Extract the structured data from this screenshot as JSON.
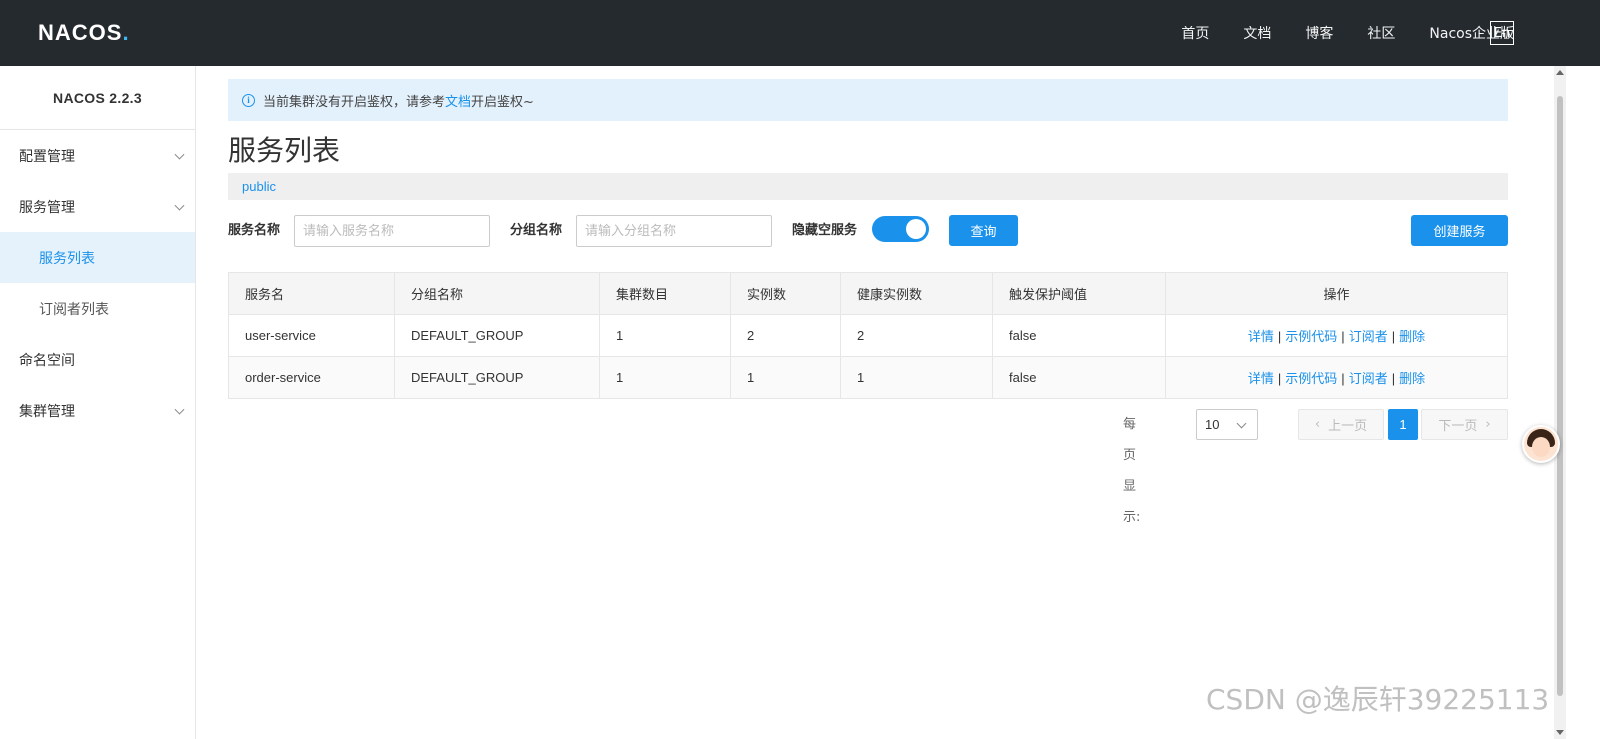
{
  "header": {
    "logo_text": "NACOS",
    "logo_dot": ".",
    "nav": [
      "首页",
      "文档",
      "博客",
      "社区",
      "Nacos企业版"
    ],
    "lang_button": "En"
  },
  "sidebar": {
    "title": "NACOS 2.2.3",
    "items": [
      {
        "label": "配置管理"
      },
      {
        "label": "服务管理"
      },
      {
        "label": "服务列表"
      },
      {
        "label": "订阅者列表"
      },
      {
        "label": "命名空间"
      },
      {
        "label": "集群管理"
      }
    ]
  },
  "notice": {
    "before": "当前集群没有开启鉴权，请参考",
    "link": "文档",
    "after": "开启鉴权~"
  },
  "page": {
    "title": "服务列表",
    "namespace": "public"
  },
  "filters": {
    "service_label": "服务名称",
    "service_placeholder": "请输入服务名称",
    "group_label": "分组名称",
    "group_placeholder": "请输入分组名称",
    "hide_empty_label": "隐藏空服务",
    "hide_empty_on": true,
    "query_button": "查询",
    "create_button": "创建服务"
  },
  "table": {
    "columns": [
      "服务名",
      "分组名称",
      "集群数目",
      "实例数",
      "健康实例数",
      "触发保护阈值",
      "操作"
    ],
    "rows": [
      [
        "user-service",
        "DEFAULT_GROUP",
        "1",
        "2",
        "2",
        "false"
      ],
      [
        "order-service",
        "DEFAULT_GROUP",
        "1",
        "1",
        "1",
        "false"
      ]
    ],
    "actions": [
      "详情",
      "示例代码",
      "订阅者",
      "删除"
    ],
    "action_separator": "|"
  },
  "pagination": {
    "page_size_label": "每页显示:",
    "page_size": "10",
    "prev": "上一页",
    "current": "1",
    "next": "下一页"
  },
  "watermark": "CSDN @逸辰轩39225113",
  "colors": {
    "header_bg": "#252a2f",
    "accent": "#1a91eb",
    "notice_bg": "#e3f1fc"
  }
}
